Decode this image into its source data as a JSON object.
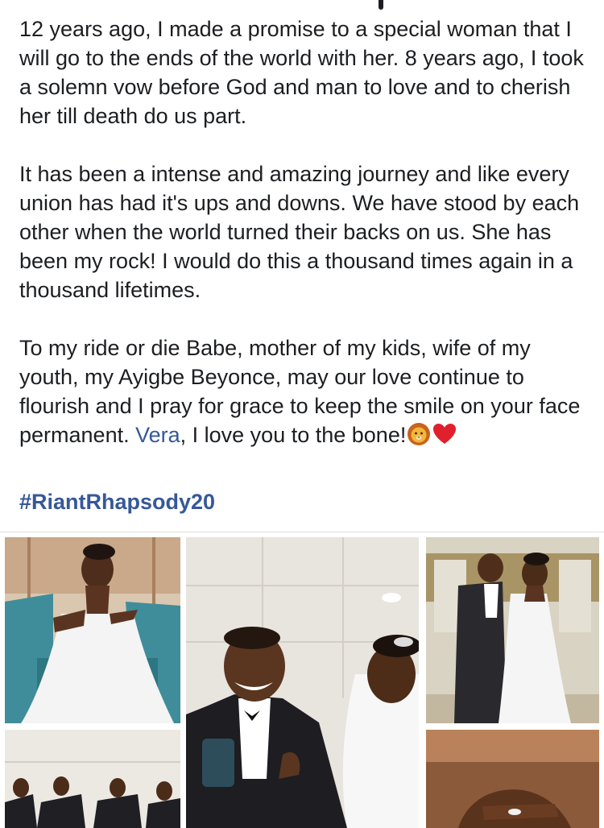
{
  "post": {
    "paragraphs": [
      "12 years ago, I made a promise to a special woman that I will go to the ends of the world with her. 8 years ago, I took a solemn vow before God and man to love and to cherish her till death do us part.",
      "It has been a intense and amazing journey and like every union has had it's ups and downs. We have stood by each other when the world turned their backs on us. She has been my rock! I would do this a thousand times again in a thousand lifetimes."
    ],
    "last_paragraph": {
      "before": "To my ride or die Babe, mother of my kids, wife of my youth, my Ayigbe Beyonce, may our love continue to flourish and I pray for grace to keep the smile on your face permanent. ",
      "mention": "Vera",
      "after": ", I love you to the bone!"
    },
    "emojis": [
      "lion-face-icon",
      "red-heart-icon"
    ],
    "hashtag": "#RiantRhapsody20"
  },
  "photos": [
    "photo-bride-armchair",
    "photo-groom-bride-smiling",
    "photo-couple-standing",
    "photo-groomsmen",
    "photo-hands-rings"
  ],
  "colors": {
    "link": "#365899",
    "text": "#1c1e21"
  }
}
